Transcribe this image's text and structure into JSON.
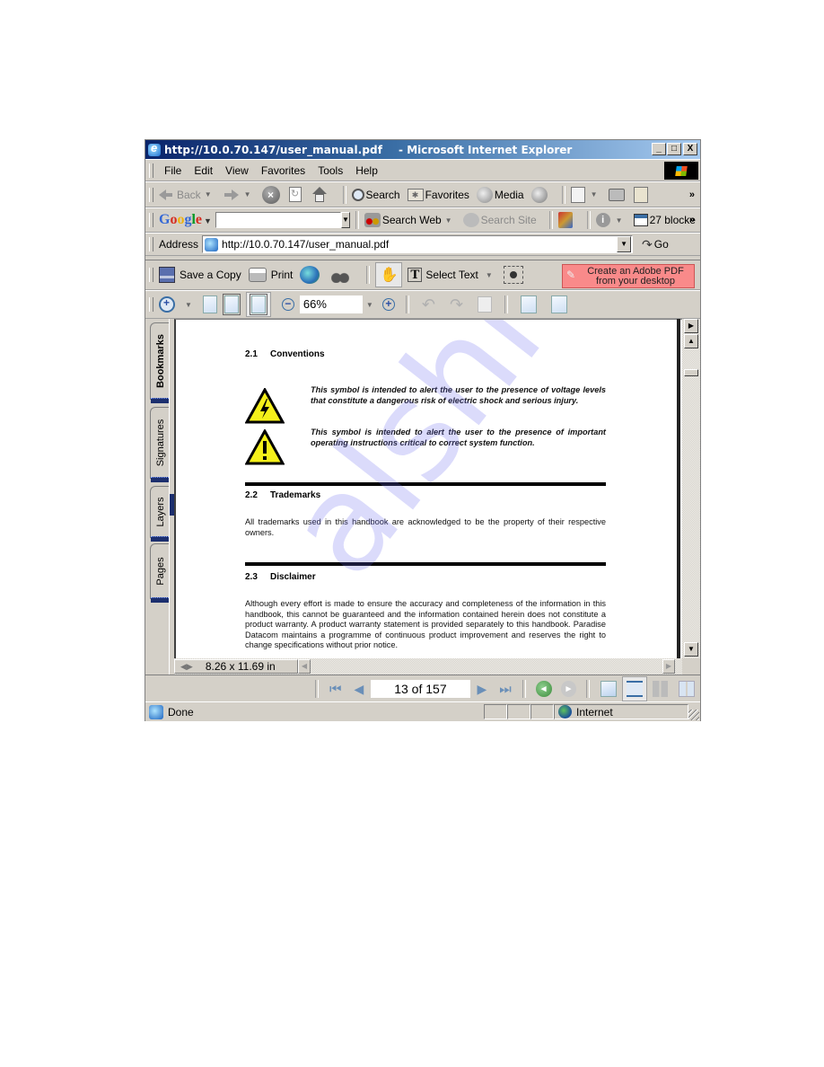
{
  "window": {
    "title_url": "http://10.0.70.147/user_manual.pdf",
    "title_app": "- Microsoft Internet Explorer",
    "buttons": {
      "minimize": "_",
      "maximize": "□",
      "close": "X"
    }
  },
  "menu": [
    "File",
    "Edit",
    "View",
    "Favorites",
    "Tools",
    "Help"
  ],
  "standard_toolbar": {
    "back": "Back",
    "search": "Search",
    "favorites": "Favorites",
    "media": "Media",
    "more": "»"
  },
  "google_toolbar": {
    "logo": [
      "G",
      "o",
      "o",
      "g",
      "l",
      "e"
    ],
    "search_value": "",
    "search_web": "Search Web",
    "search_site": "Search Site",
    "popup_blocked": "27 blocke",
    "more": "»"
  },
  "address_bar": {
    "label": "Address",
    "url": "http://10.0.70.147/user_manual.pdf",
    "go": "Go"
  },
  "acrobat_toolbar": {
    "save_copy": "Save a Copy",
    "print": "Print",
    "select_text": "Select Text",
    "create_pdf_line1": "Create an Adobe PDF",
    "create_pdf_line2": "from your desktop",
    "zoom_value": "66%"
  },
  "nav_tabs": [
    {
      "label": "Bookmarks",
      "active": true
    },
    {
      "label": "Signatures",
      "active": false
    },
    {
      "label": "Layers",
      "active": false
    },
    {
      "label": "Pages",
      "active": false
    }
  ],
  "document": {
    "sections": [
      {
        "number": "2.1",
        "title": "Conventions"
      },
      {
        "number": "2.2",
        "title": "Trademarks"
      },
      {
        "number": "2.3",
        "title": "Disclaimer"
      }
    ],
    "warning_voltage": "This symbol is intended to alert the user to the presence of voltage levels that constitute a dangerous risk of electric shock and serious injury.",
    "warning_instructions": "This symbol is intended to alert the user to the presence of important operating instructions critical to correct system function.",
    "trademarks_text": "All trademarks used in this handbook are acknowledged to be the property of their respective owners.",
    "disclaimer_text": "Although every effort is made to ensure the accuracy and completeness of the information in this handbook, this cannot be guaranteed and the information contained herein does not constitute a product warranty. A product warranty statement is provided separately to this handbook. Paradise Datacom maintains a programme of continuous product improvement and reserves the right to change specifications without prior notice.",
    "watermark": "alshive.com"
  },
  "page_size": "8.26 x 11.69 in",
  "page_nav": {
    "current_page": 13,
    "total_pages": 157,
    "display": "13 of 157"
  },
  "status_bar": {
    "status": "Done",
    "zone": "Internet"
  }
}
